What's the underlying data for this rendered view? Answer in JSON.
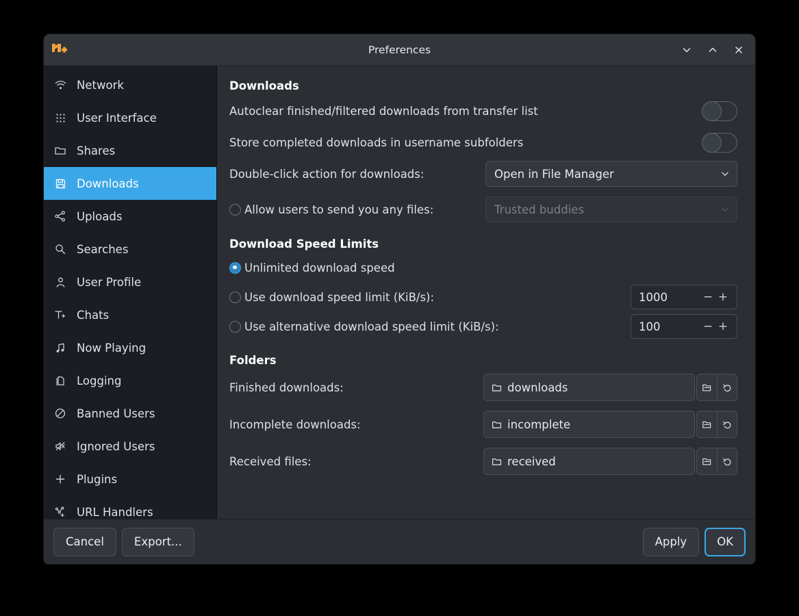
{
  "window": {
    "title": "Preferences",
    "logo_icon": "nicotine-plus-logo",
    "controls": [
      {
        "name": "minimize",
        "icon": "chevron-down-icon"
      },
      {
        "name": "maximize",
        "icon": "chevron-up-icon"
      },
      {
        "name": "close",
        "icon": "close-icon"
      }
    ]
  },
  "colors": {
    "accent": "#3ba7e8",
    "window_bg": "#2b2e33",
    "sidebar_bg": "#1a1d21",
    "titlebar_bg": "#32363b",
    "logo_orange": "#f5a council"
  },
  "sidebar": {
    "selected": "Downloads",
    "items": [
      {
        "label": "Network",
        "icon": "wifi-icon"
      },
      {
        "label": "User Interface",
        "icon": "grid-dots-icon"
      },
      {
        "label": "Shares",
        "icon": "folder-icon"
      },
      {
        "label": "Downloads",
        "icon": "save-disk-icon"
      },
      {
        "label": "Uploads",
        "icon": "share-nodes-icon"
      },
      {
        "label": "Searches",
        "icon": "search-icon"
      },
      {
        "label": "User Profile",
        "icon": "person-icon"
      },
      {
        "label": "Chats",
        "icon": "text-add-icon"
      },
      {
        "label": "Now Playing",
        "icon": "music-note-icon"
      },
      {
        "label": "Logging",
        "icon": "documents-icon"
      },
      {
        "label": "Banned Users",
        "icon": "block-icon"
      },
      {
        "label": "Ignored Users",
        "icon": "mute-icon"
      },
      {
        "label": "Plugins",
        "icon": "plus-icon"
      },
      {
        "label": "URL Handlers",
        "icon": "link-add-icon"
      }
    ]
  },
  "main": {
    "downloads": {
      "heading": "Downloads",
      "autoclear": {
        "label": "Autoclear finished/filtered downloads from transfer list",
        "state": "off"
      },
      "store_subfolders": {
        "label": "Store completed downloads in username subfolders",
        "state": "off"
      },
      "doubleclick": {
        "label": "Double-click action for downloads:",
        "value": "Open in File Manager"
      },
      "allow_send": {
        "label": "Allow users to send you any files:",
        "radio_checked": false,
        "value": "Trusted buddies",
        "disabled": true
      }
    },
    "speed_limits": {
      "heading": "Download Speed Limits",
      "options": [
        {
          "label": "Unlimited download speed",
          "checked": true,
          "spin": null
        },
        {
          "label": "Use download speed limit (KiB/s):",
          "checked": false,
          "spin": "1000"
        },
        {
          "label": "Use alternative download speed limit (KiB/s):",
          "checked": false,
          "spin": "100"
        }
      ],
      "spin_decrement": "−",
      "spin_increment": "+"
    },
    "folders": {
      "heading": "Folders",
      "rows": [
        {
          "label": "Finished downloads:",
          "value": "downloads"
        },
        {
          "label": "Incomplete downloads:",
          "value": "incomplete"
        },
        {
          "label": "Received files:",
          "value": "received"
        }
      ],
      "browse_icon": "folder-open-icon",
      "reset_icon": "revert-arrow-icon"
    }
  },
  "footer": {
    "cancel": "Cancel",
    "export": "Export...",
    "apply": "Apply",
    "ok": "OK"
  }
}
